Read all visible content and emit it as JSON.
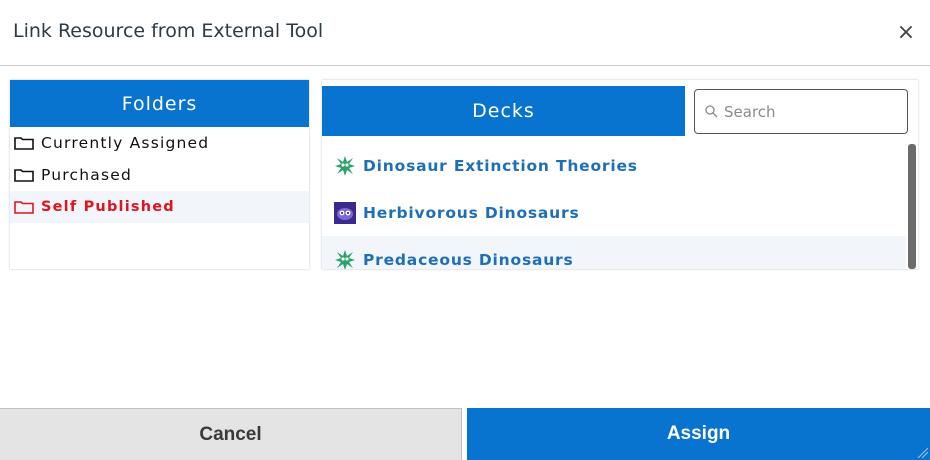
{
  "dialog": {
    "title": "Link Resource from External Tool",
    "close_label": "×"
  },
  "folders": {
    "header": "Folders",
    "items": [
      {
        "label": "Currently Assigned",
        "icon": "folder-icon",
        "active": false
      },
      {
        "label": "Purchased",
        "icon": "folder-icon",
        "active": false
      },
      {
        "label": "Self Published",
        "icon": "folder-icon",
        "active": true
      }
    ]
  },
  "decks": {
    "header": "Decks",
    "search_placeholder": "Search",
    "search_value": "",
    "items": [
      {
        "label": "Dinosaur Extinction Theories",
        "icon": "green-splat-icon",
        "active": false
      },
      {
        "label": "Herbivorous Dinosaurs",
        "icon": "purple-monster-icon",
        "active": false
      },
      {
        "label": "Predaceous Dinosaurs",
        "icon": "green-splat-icon",
        "active": true
      }
    ]
  },
  "footer": {
    "cancel_label": "Cancel",
    "assign_label": "Assign"
  },
  "colors": {
    "accent": "#0874cf",
    "active_folder": "#e0141e",
    "deck_link": "#1f6fb8",
    "cancel_bg": "#e4e4e4"
  }
}
